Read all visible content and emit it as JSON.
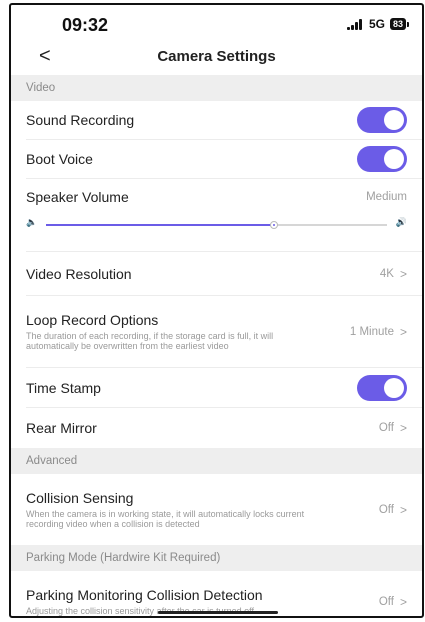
{
  "status": {
    "time": "09:32",
    "network": "5G",
    "battery": "83"
  },
  "header": {
    "title": "Camera Settings"
  },
  "sections": {
    "video": "Video",
    "advanced": "Advanced",
    "parking": "Parking Mode (Hardwire Kit Required)"
  },
  "rows": {
    "sound_recording": {
      "label": "Sound Recording",
      "on": true
    },
    "boot_voice": {
      "label": "Boot Voice",
      "on": true
    },
    "speaker_volume": {
      "label": "Speaker Volume",
      "value": "Medium",
      "level": 0.67
    },
    "video_resolution": {
      "label": "Video Resolution",
      "value": "4K"
    },
    "loop_record": {
      "label": "Loop Record Options",
      "desc": "The duration of each recording, if the storage card is full, it will automatically be overwritten from the earliest video",
      "value": "1 Minute"
    },
    "time_stamp": {
      "label": "Time Stamp",
      "on": true
    },
    "rear_mirror": {
      "label": "Rear Mirror",
      "value": "Off"
    },
    "collision_sensing": {
      "label": "Collision Sensing",
      "desc": "When the camera is in working state, it will automatically locks current recording video when a collision is detected",
      "value": "Off"
    },
    "parking_collision": {
      "label": "Parking Monitoring Collision Detection",
      "desc": "Adjusting the collision sensitivity after the car is turned off",
      "value": "Off"
    }
  },
  "colors": {
    "accent": "#6b5ce7",
    "section_bg": "#eeeeee"
  },
  "icons": {
    "back": "chevron-left-icon",
    "chevron": "chevron-right-icon",
    "speaker": "speaker-icon"
  }
}
